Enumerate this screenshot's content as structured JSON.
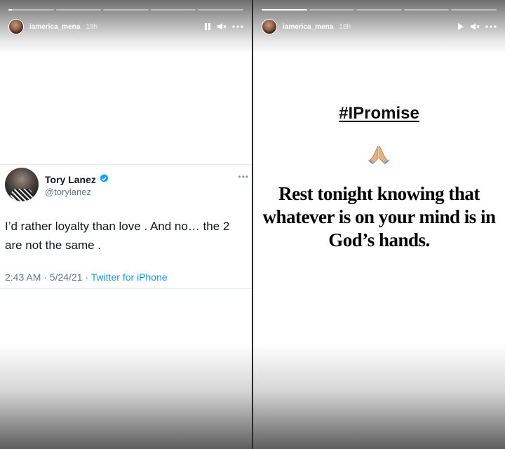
{
  "left_story": {
    "username": "iamerica_mena",
    "time_ago": "19h",
    "progress": {
      "segments": 5,
      "completed": 0,
      "current": 0
    },
    "controls": [
      "pause-icon",
      "mute-icon",
      "more-icon"
    ],
    "tweet": {
      "name": "Tory Lanez",
      "handle": "@torylanez",
      "verified": true,
      "text": "I’d rather loyalty than love . And no… the 2 are not the same .",
      "date": "2:43 AM · 5/24/21 · ",
      "source": "Twitter for iPhone"
    }
  },
  "right_story": {
    "username": "iamerica_mena",
    "time_ago": "18h",
    "progress": {
      "segments": 5,
      "completed": 1,
      "current": 1
    },
    "controls": [
      "play-icon",
      "mute-icon",
      "more-icon"
    ],
    "hashtag": "#IPromise",
    "emoji": "🙏",
    "message": "Rest tonight knowing that whatever is on your mind is in God’s hands."
  },
  "colors": {
    "twitter_blue": "#1b95e0",
    "verified_blue": "#1da1f2",
    "gray_text": "#657786"
  }
}
